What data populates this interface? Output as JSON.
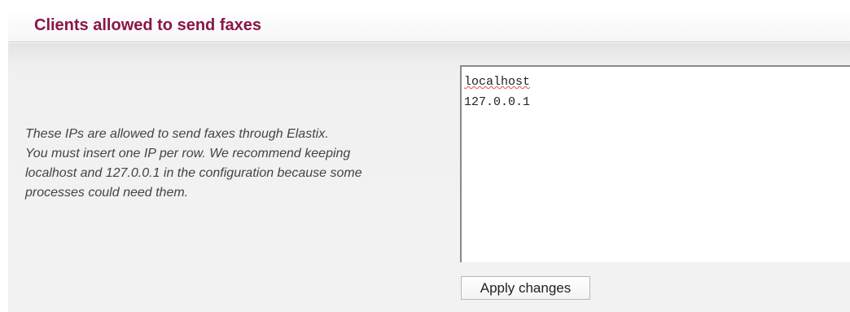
{
  "header": {
    "title": "Clients allowed to send faxes"
  },
  "description": {
    "lines": [
      "These IPs are allowed to send faxes through Elastix.",
      "You must insert one IP per row. We recommend keeping",
      "localhost and 127.0.0.1 in the configuration because some",
      "processes could need them."
    ]
  },
  "allowed_clients": {
    "entries": [
      "localhost",
      "127.0.0.1"
    ]
  },
  "actions": {
    "apply_label": "Apply changes"
  }
}
